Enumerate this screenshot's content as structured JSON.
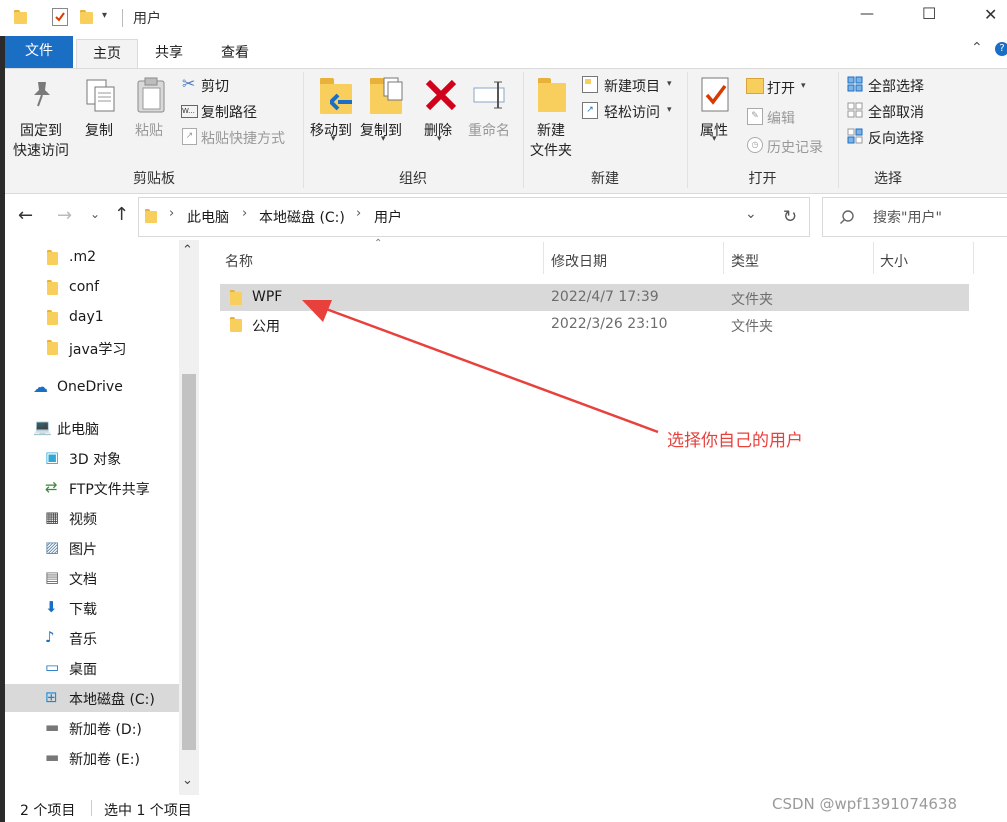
{
  "window": {
    "title": "用户",
    "controls": {
      "minimize": "—",
      "maximize": "☐",
      "close": "✕"
    }
  },
  "tabs": [
    {
      "label": "文件",
      "active": false,
      "primary": true
    },
    {
      "label": "主页",
      "active": true
    },
    {
      "label": "共享",
      "active": false
    },
    {
      "label": "查看",
      "active": false
    }
  ],
  "ribbon": {
    "clipboard": {
      "group": "剪贴板",
      "pin_line1": "固定到",
      "pin_line2": "快速访问",
      "copy": "复制",
      "paste": "粘贴",
      "cut": "剪切",
      "copy_path": "复制路径",
      "paste_shortcut": "粘贴快捷方式"
    },
    "organize": {
      "group": "组织",
      "move_to": "移动到",
      "copy_to": "复制到",
      "delete": "删除",
      "rename": "重命名"
    },
    "new": {
      "group": "新建",
      "new_folder_line1": "新建",
      "new_folder_line2": "文件夹",
      "new_item": "新建项目",
      "easy_access": "轻松访问"
    },
    "open": {
      "group": "打开",
      "properties": "属性",
      "open": "打开",
      "edit": "编辑",
      "history": "历史记录"
    },
    "select": {
      "group": "选择",
      "select_all": "全部选择",
      "select_none": "全部取消",
      "invert": "反向选择"
    }
  },
  "address": {
    "crumbs": [
      "此电脑",
      "本地磁盘 (C:)",
      "用户"
    ],
    "search_placeholder": "搜索\"用户\""
  },
  "sidebar": {
    "items": [
      {
        "label": ".m2",
        "icon": "folder-icon"
      },
      {
        "label": "conf",
        "icon": "folder-icon"
      },
      {
        "label": "day1",
        "icon": "folder-icon"
      },
      {
        "label": "java学习",
        "icon": "folder-icon"
      },
      {
        "label": "OneDrive",
        "icon": "onedrive-icon"
      },
      {
        "label": "此电脑",
        "icon": "computer-icon"
      },
      {
        "label": "3D 对象",
        "icon": "cube-icon"
      },
      {
        "label": "FTP文件共享",
        "icon": "network-icon"
      },
      {
        "label": "视频",
        "icon": "video-icon"
      },
      {
        "label": "图片",
        "icon": "picture-icon"
      },
      {
        "label": "文档",
        "icon": "document-icon"
      },
      {
        "label": "下载",
        "icon": "download-icon"
      },
      {
        "label": "音乐",
        "icon": "music-icon"
      },
      {
        "label": "桌面",
        "icon": "desktop-icon"
      },
      {
        "label": "本地磁盘 (C:)",
        "icon": "windows-drive-icon",
        "selected": true
      },
      {
        "label": "新加卷 (D:)",
        "icon": "drive-icon"
      },
      {
        "label": "新加卷 (E:)",
        "icon": "drive-icon"
      }
    ]
  },
  "table": {
    "columns": [
      "名称",
      "修改日期",
      "类型",
      "大小"
    ],
    "rows": [
      {
        "name": "WPF",
        "date": "2022/4/7 17:39",
        "type": "文件夹",
        "size": "",
        "selected": true
      },
      {
        "name": "公用",
        "date": "2022/3/26 23:10",
        "type": "文件夹",
        "size": "",
        "selected": false
      }
    ]
  },
  "annotation": {
    "text": "选择你自己的用户",
    "color": "#e8413c"
  },
  "status": {
    "count": "2 个项目",
    "selected": "选中 1 个项目"
  },
  "watermark": "CSDN @wpf1391074638",
  "colors": {
    "accent": "#1a6fc4",
    "selection": "#d9d9d9",
    "ribbon_bg": "#f3f3f3"
  }
}
